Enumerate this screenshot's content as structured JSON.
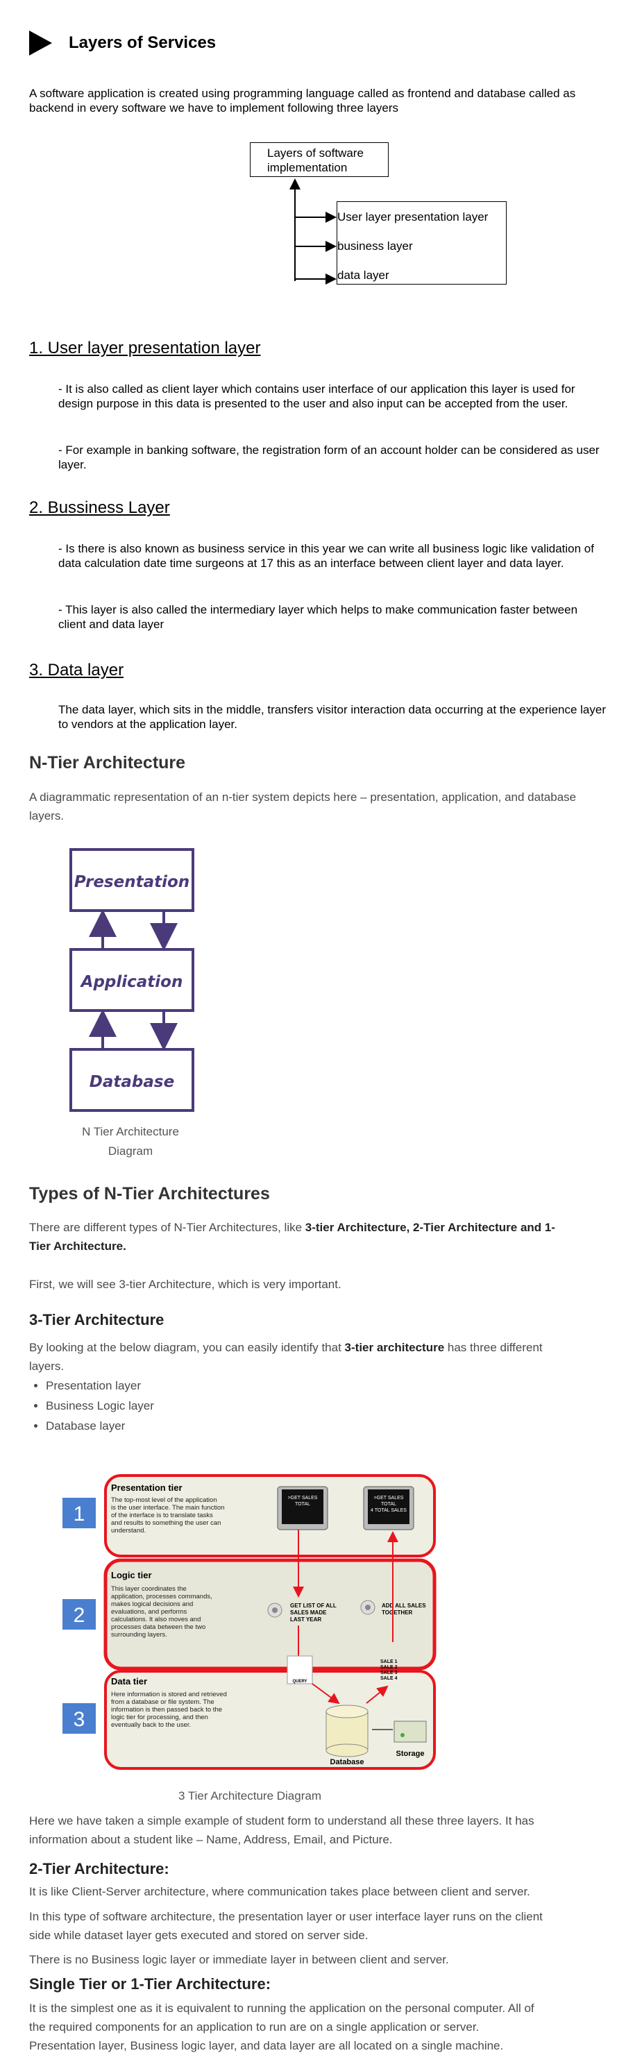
{
  "title": "Layers of Services",
  "intro": "A software application is created using programming language called as frontend and database called as backend in every software we have to implement following three layers",
  "layer_diagram": {
    "top_box": "Layers of software implementation",
    "items": [
      "User layer presentation layer",
      "business layer",
      "data layer"
    ]
  },
  "sections": [
    {
      "heading": "1. User layer presentation layer",
      "paragraphs": [
        "- It is also called as client layer which contains user interface of our application this layer is used for design purpose in this data is presented to the user and also input can be accepted from the user.",
        "- For example in banking software, the registration form of an account holder can be considered as user layer."
      ]
    },
    {
      "heading": "2. Bussiness Layer",
      "paragraphs": [
        "- Is there is also known as business service in this year we can write all business logic like validation of data calculation date time surgeons at 17 this as an interface between client layer and data layer.",
        "- This layer is also called the intermediary layer which helps to make communication faster between client and data layer"
      ]
    },
    {
      "heading": "3. Data layer",
      "paragraphs": [
        "The data layer, which sits in the middle, transfers visitor interaction data occurring at the experience layer to vendors at the application layer."
      ]
    }
  ],
  "ntier": {
    "heading": "N-Tier Architecture",
    "description": "A diagrammatic representation of an n-tier system depicts here – presentation, application, and database layers.",
    "boxes": [
      "Presentation",
      "Application",
      "Database"
    ],
    "caption_line1": "N Tier Architecture",
    "caption_line2": "Diagram"
  },
  "types": {
    "heading": "Types of N-Tier Architectures",
    "p1_plain": "There are different types of N-Tier Architectures, like ",
    "p1_bold1": "3-tier Architecture, 2-Tier Architecture and 1-",
    "p1_bold2": "Tier Architecture.",
    "p2": "First, we will see 3-tier Architecture, which is very important."
  },
  "three_tier": {
    "heading": "3-Tier Architecture",
    "p_plain1": "By looking at the below diagram, you can easily identify that ",
    "p_bold": "3-tier architecture",
    "p_plain2": " has three different",
    "p_line2": "layers.",
    "bullets": [
      "Presentation layer",
      "Business Logic layer",
      "Database layer"
    ],
    "diagram": {
      "tiers": [
        {
          "num": "1",
          "title": "Presentation tier",
          "text": [
            "The top-most level of the application",
            "is the user interface. The main function",
            "of the interface is to translate tasks",
            "and results to something the user can",
            "understand."
          ]
        },
        {
          "num": "2",
          "title": "Logic tier",
          "text": [
            "This layer coordinates the",
            "application, processes commands,",
            "makes logical decisions and",
            "evaluations, and performs",
            "calculations.  It also moves and",
            "processes data between the two",
            "surrounding layers."
          ]
        },
        {
          "num": "3",
          "title": "Data tier",
          "text": [
            "Here information is stored and retrieved",
            "from a database or file system.  The",
            "information is then passed back to the",
            "logic tier for processing, and then",
            "eventually back to the user."
          ]
        }
      ],
      "screen1": [
        ">GET SALES",
        "TOTAL"
      ],
      "screen2": [
        ">GET SALES",
        "TOTAL",
        "4 TOTAL SALES"
      ],
      "logic_left": [
        "GET LIST OF ALL",
        "SALES MADE",
        "LAST YEAR"
      ],
      "logic_right": [
        "ADD ALL SALES",
        "TOGETHER"
      ],
      "query": "QUERY",
      "sales": [
        "SALE 1",
        "SALE 2",
        "SALE 3",
        "SALE 4"
      ],
      "database": "Database",
      "storage": "Storage"
    },
    "caption": "3 Tier Architecture Diagram",
    "after1": "Here we have taken a simple example of student form to understand all these three layers. It has",
    "after2": "information about a student like – Name, Address, Email, and Picture."
  },
  "two_tier": {
    "heading": "2-Tier Architecture:",
    "p1": "It is like Client-Server architecture, where communication takes place between client and server.",
    "p2a": "In this type of software architecture, the presentation layer or user interface layer runs on the client",
    "p2b": "side while dataset layer gets executed and stored on server side.",
    "p3": "There is no Business logic layer or immediate layer in between client and server."
  },
  "one_tier": {
    "heading": "Single Tier or 1-Tier Architecture:",
    "p1a": "It is the simplest one as it is equivalent to running the application on the personal computer. All of",
    "p1b": "the required components for an application to run are on a single application or server.",
    "p2": "Presentation layer, Business logic layer, and data layer are all located on a single machine."
  },
  "colors": {
    "ntier_purple": "#4b3a7a",
    "tier_red": "#e8151e",
    "tier_number_blue": "#4a7fd0",
    "tier_bg": "#eeeee2"
  }
}
